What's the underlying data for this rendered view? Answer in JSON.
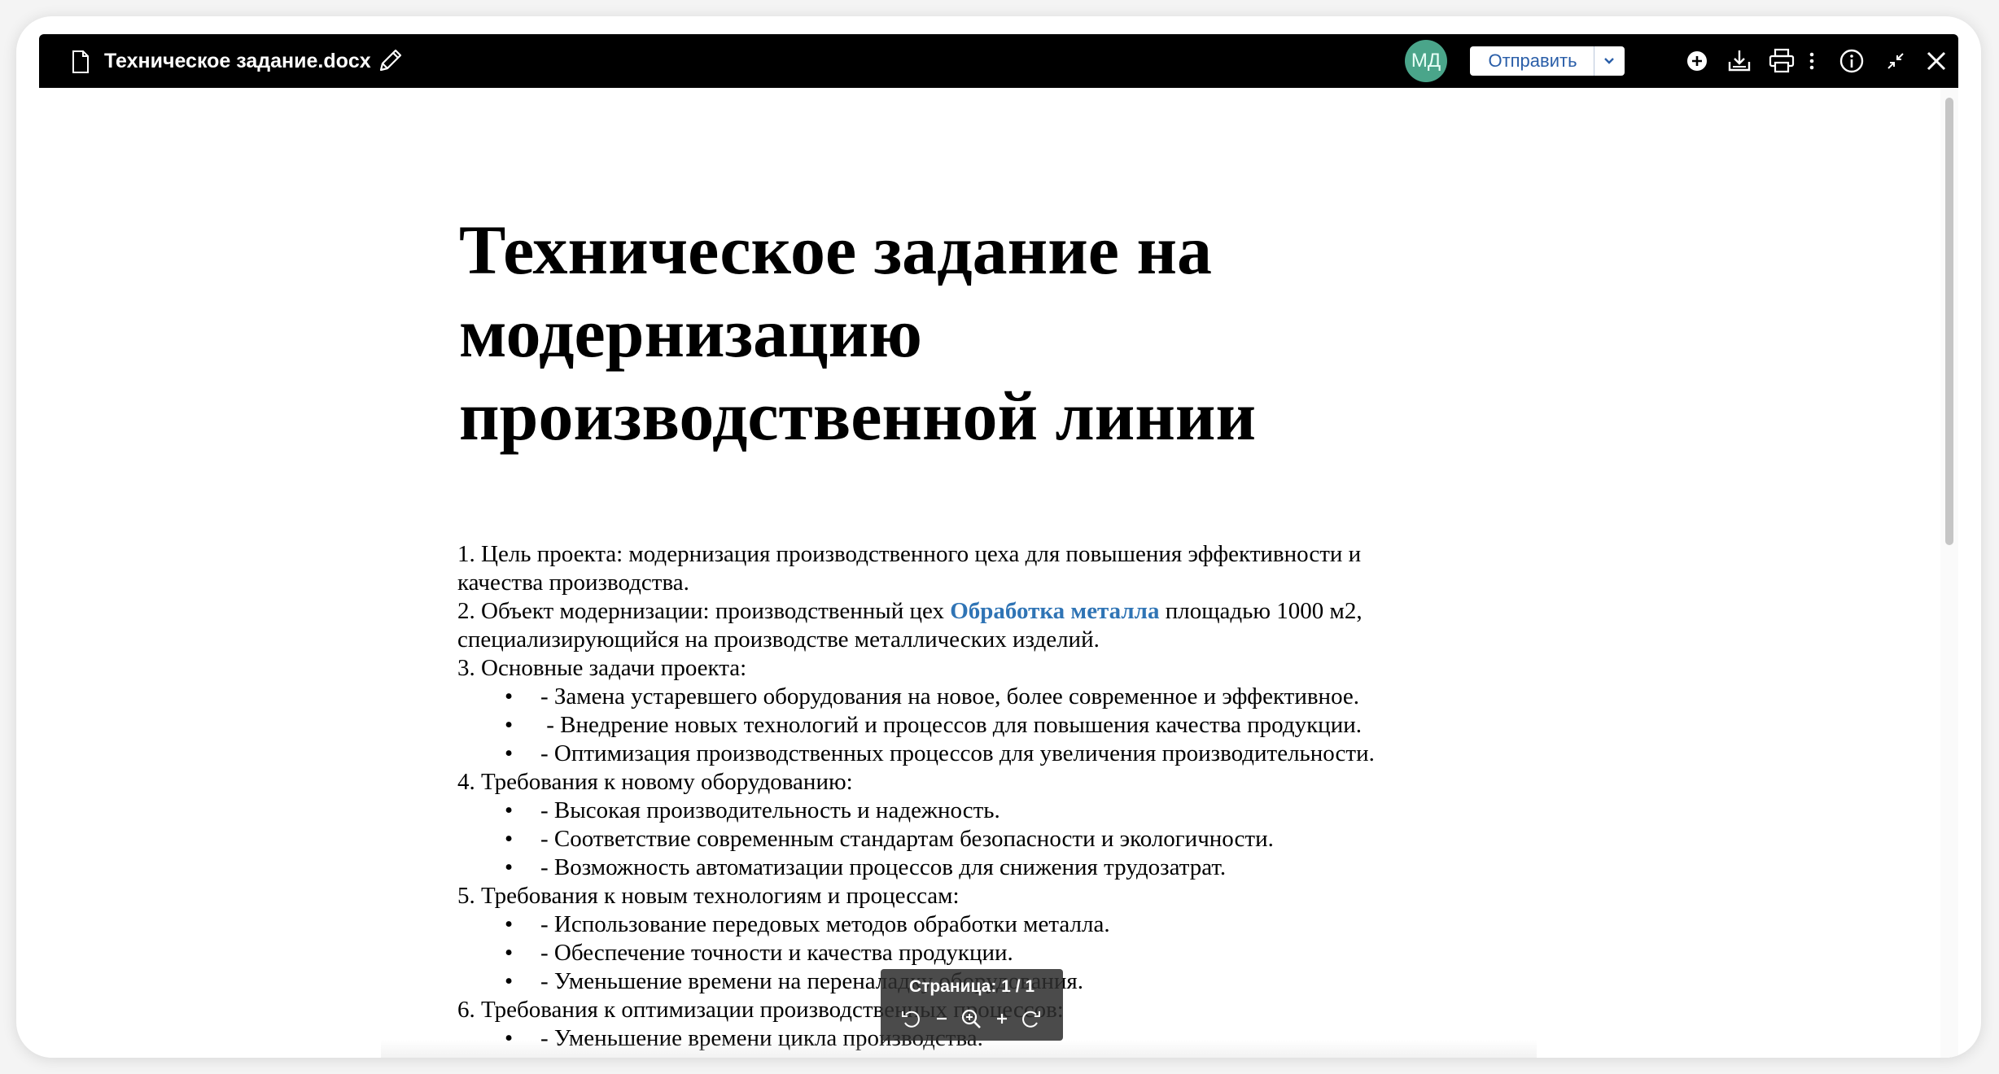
{
  "header": {
    "file_name": "Техническое задание.docx",
    "avatar_initials": "МД",
    "send_label": "Отправить",
    "icons": [
      "file-icon",
      "pencil-icon",
      "chevron-down-icon",
      "add-circle-icon",
      "download-icon",
      "print-icon",
      "more-vertical-icon",
      "info-icon",
      "collapse-icon",
      "close-icon"
    ],
    "avatar_color": "#4aa58a"
  },
  "document": {
    "title_lines": [
      "Техническое задание на",
      "модернизацию",
      "производственной линии"
    ],
    "p1_line1": "1. Цель проекта: модернизация производственного цеха для повышения эффективности и",
    "p1_line2": "качества производства.",
    "p2_before": "2. Объект модернизации: производственный цех ",
    "p2_link": "Обработка металла",
    "p2_after": " площадью 1000 м2,",
    "p2_line2": "специализирующийся на производстве металлических изделий.",
    "p3": "3. Основные задачи проекта:",
    "p3_items": [
      "- Замена устаревшего оборудования на новое, более современное и эффективное.",
      " - Внедрение новых технологий и процессов для повышения качества продукции.",
      "- Оптимизация производственных процессов для увеличения производительности."
    ],
    "p4": "4. Требования к новому оборудованию:",
    "p4_items": [
      "- Высокая производительность и надежность.",
      "- Соответствие современным стандартам безопасности и экологичности.",
      "- Возможность автоматизации процессов для снижения трудозатрат."
    ],
    "p5": "5. Требования к новым технологиям и процессам:",
    "p5_items": [
      "- Использование передовых методов обработки металла.",
      "- Обеспечение точности и качества продукции.",
      "- Уменьшение времени на переналадку оборудования."
    ],
    "p6": "6. Требования к оптимизации производственных процессов:",
    "p6_items": [
      "- Уменьшение времени цикла производства."
    ],
    "link_color": "#2f74b5"
  },
  "page_toolbar": {
    "label": "Страница: 1 / 1",
    "icons": [
      "rotate-left-icon",
      "zoom-out-icon",
      "zoom-icon",
      "zoom-in-icon",
      "rotate-right-icon"
    ]
  }
}
